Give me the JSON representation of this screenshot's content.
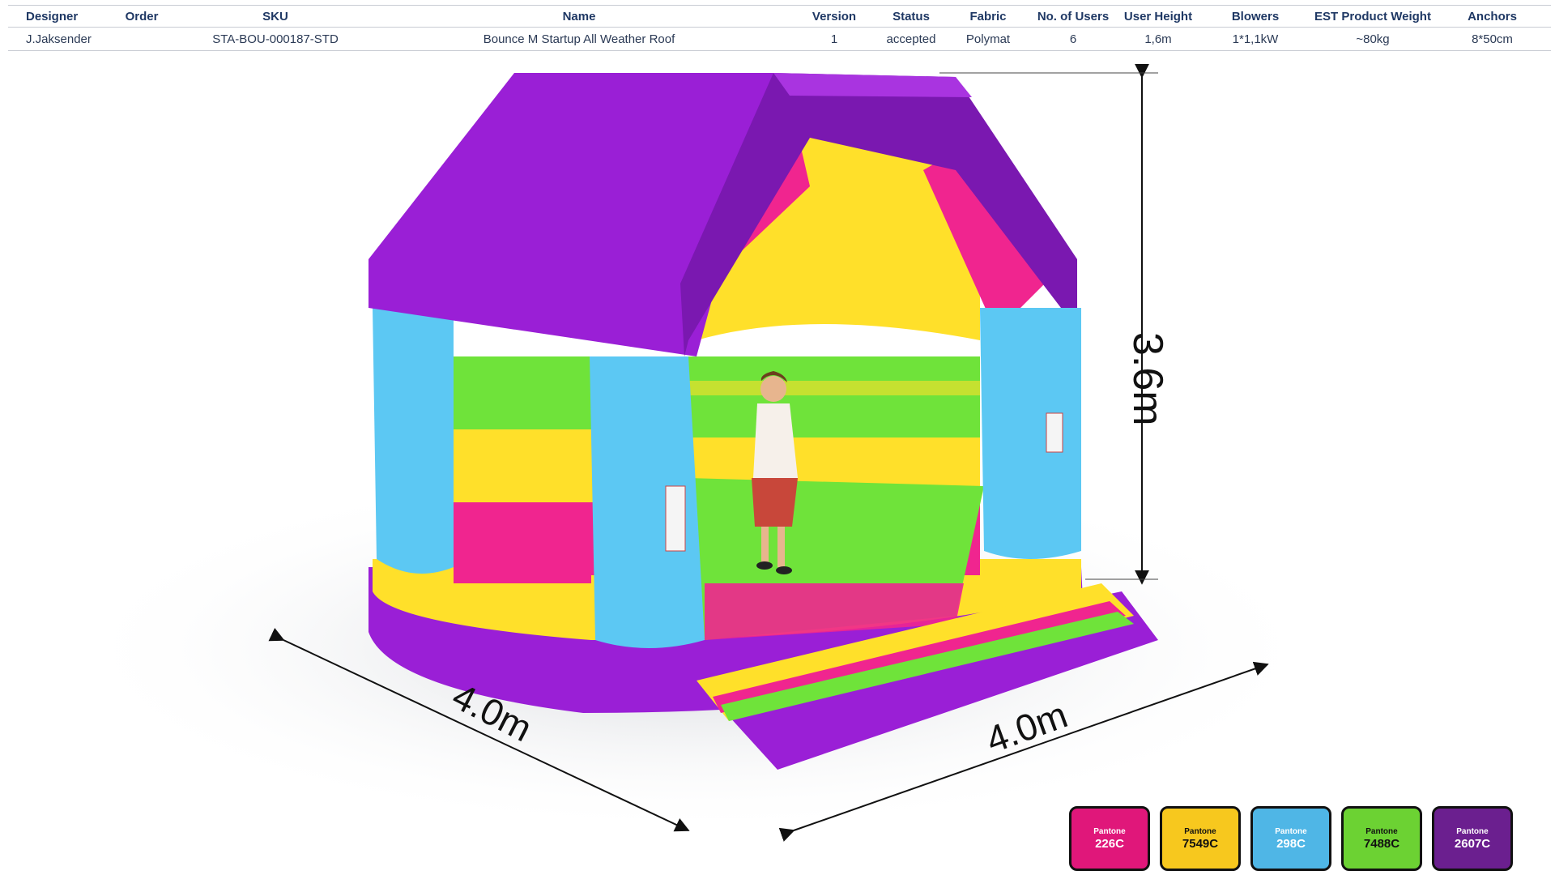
{
  "spec": {
    "headers": {
      "designer": "Designer",
      "order": "Order",
      "sku": "SKU",
      "name": "Name",
      "version": "Version",
      "status": "Status",
      "fabric": "Fabric",
      "users": "No. of Users",
      "height": "User  Height",
      "blowers": "Blowers",
      "weight": "EST Product Weight",
      "anchors": "Anchors"
    },
    "row": {
      "designer": "J.Jaksender",
      "order": "",
      "sku": "STA-BOU-000187-STD",
      "name": "Bounce M Startup All Weather Roof",
      "version": "1",
      "status": "accepted",
      "fabric": "Polymat",
      "users": "6",
      "height": "1,6m",
      "blowers": "1*1,1kW",
      "weight": "~80kg",
      "anchors": "8*50cm"
    }
  },
  "dimensions": {
    "height": "3.6m",
    "depth": "4.0m",
    "width": "4.0m"
  },
  "swatches": [
    {
      "brand": "Pantone",
      "code": "226C",
      "color": "#e0177a",
      "text_color": "#ffffff"
    },
    {
      "brand": "Pantone",
      "code": "7549C",
      "color": "#f7c81e",
      "text_color": "#111111"
    },
    {
      "brand": "Pantone",
      "code": "298C",
      "color": "#4fb6e6",
      "text_color": "#ffffff"
    },
    {
      "brand": "Pantone",
      "code": "7488C",
      "color": "#6cd233",
      "text_color": "#111111"
    },
    {
      "brand": "Pantone",
      "code": "2607C",
      "color": "#6b1f8f",
      "text_color": "#ffffff"
    }
  ],
  "colors": {
    "purple": "#9a1fd6",
    "purple_dark": "#7a18b0",
    "yellow": "#ffe02a",
    "pink": "#f0258f",
    "blue": "#5cc8f3",
    "green": "#6fe33a"
  }
}
